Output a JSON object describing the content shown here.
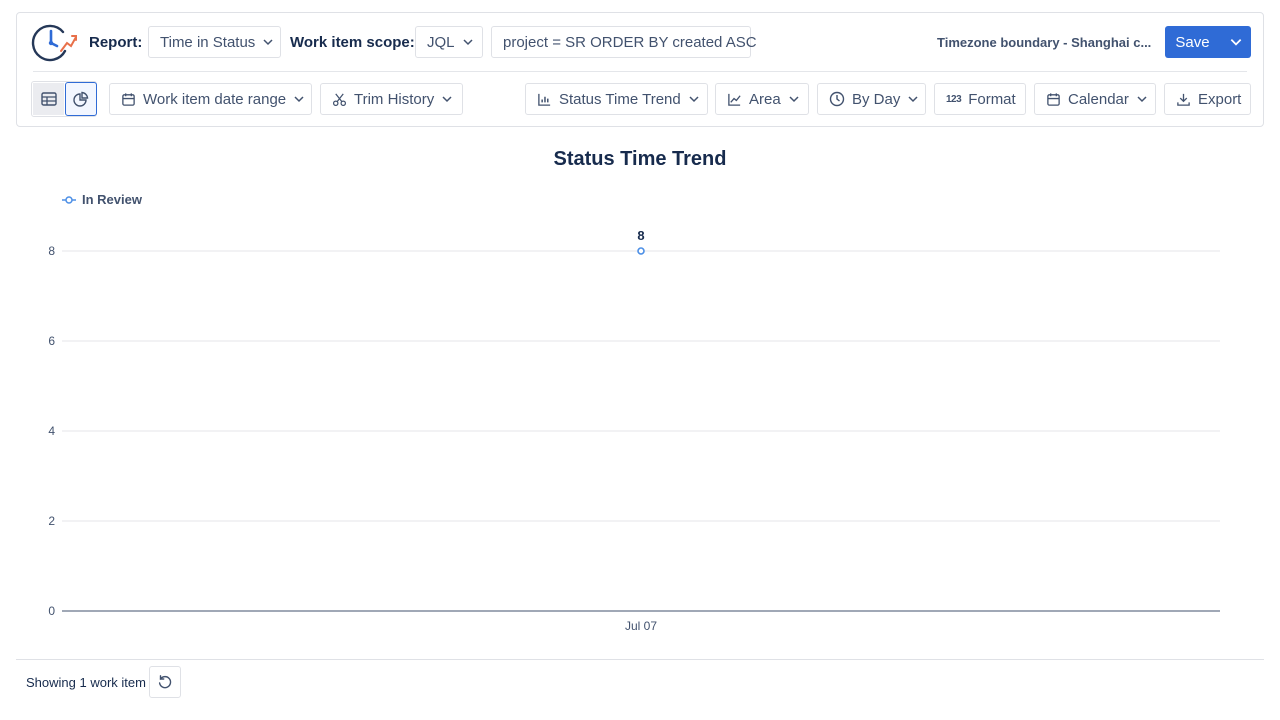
{
  "header": {
    "report_label": "Report:",
    "report_value": "Time in Status",
    "scope_label": "Work item scope:",
    "scope_type": "JQL",
    "jql_value": "project = SR ORDER BY created ASC",
    "timezone": "Timezone boundary - Shanghai c...",
    "save_label": "Save"
  },
  "toolbar": {
    "date_range": "Work item date range",
    "trim_history": "Trim History",
    "chart_type": "Status Time Trend",
    "chart_style": "Area",
    "granularity": "By Day",
    "format": "Format",
    "format_icon": "123",
    "calendar": "Calendar",
    "export": "Export"
  },
  "chart_data": {
    "type": "line",
    "title": "Status Time Trend",
    "x": [
      "Jul 07"
    ],
    "series": [
      {
        "name": "In Review",
        "values": [
          8
        ],
        "color": "#4c8fe6"
      }
    ],
    "ylim": [
      0,
      8
    ],
    "yticks": [
      "0",
      "2",
      "4",
      "6",
      "8"
    ],
    "data_labels": [
      "8"
    ],
    "grid": true,
    "legend": "top-left"
  },
  "footer": {
    "showing": "Showing 1 work item"
  },
  "colors": {
    "accent": "#2f6bd6",
    "series": "#4c8fe6",
    "logo_orange": "#e8704a"
  }
}
